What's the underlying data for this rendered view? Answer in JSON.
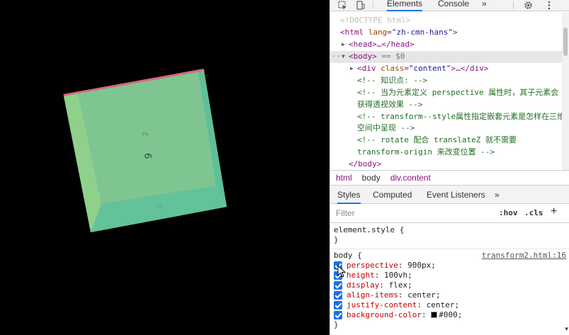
{
  "devtools": {
    "tabs": {
      "elements": "Elements",
      "console": "Console",
      "more": "»"
    },
    "dom": {
      "doctype": "<!DOCTYPE html>",
      "html_open_tag": "<html",
      "html_lang_attr": "lang",
      "html_lang_val": "\"zh-cmn-hans\"",
      "head": "<head>…</head>",
      "body_tag": "<body>",
      "body_marker": " == $0",
      "div_open": "<div",
      "div_class_attr": "class",
      "div_class_val": "\"content\"",
      "div_rest": ">…</div>",
      "comment1": "<!-- 知识点: -->",
      "comment2": "<!-- 当为元素定义 perspective 属性时，其子元素会获得透视效果 -->",
      "comment3": "<!-- transform--style属性指定嵌套元素是怎样在三维空间中呈现 -->",
      "comment4": "<!-- rotate 配合 translateZ 就不需要 transform-origin 来改变位置 -->",
      "body_close": "</body>"
    },
    "breadcrumbs": {
      "html": "html",
      "body": "body",
      "div": "div.content"
    },
    "subtabs": {
      "styles": "Styles",
      "computed": "Computed",
      "listeners": "Event Listeners",
      "more": "»"
    },
    "filter": {
      "placeholder": "Filter",
      "hov": ":hov",
      "cls": ".cls",
      "add": "+"
    },
    "element_style": {
      "selector": "element.style {",
      "close": "}"
    },
    "body_rule": {
      "selector": "body {",
      "source": "transform2.html:16",
      "close": "}",
      "declarations": [
        {
          "prop": "perspective",
          "value": "900px;"
        },
        {
          "prop": "height",
          "value": "100vh;"
        },
        {
          "prop": "display",
          "value": "flex;"
        },
        {
          "prop": "align-items",
          "value": "center;"
        },
        {
          "prop": "justify-content",
          "value": "center;"
        },
        {
          "prop": "background-color",
          "value": "#000;"
        }
      ]
    }
  },
  "viewport": {
    "face_labels": {
      "front": "6",
      "back": "2"
    },
    "colors": {
      "face_main": "#7cc48e",
      "face_dark": "#5fbf98",
      "edge_pink": "#d46b7c",
      "background": "#000000"
    }
  },
  "colors": {
    "accent": "#1a73e8",
    "tag": "#881280",
    "comment": "#236e25"
  }
}
